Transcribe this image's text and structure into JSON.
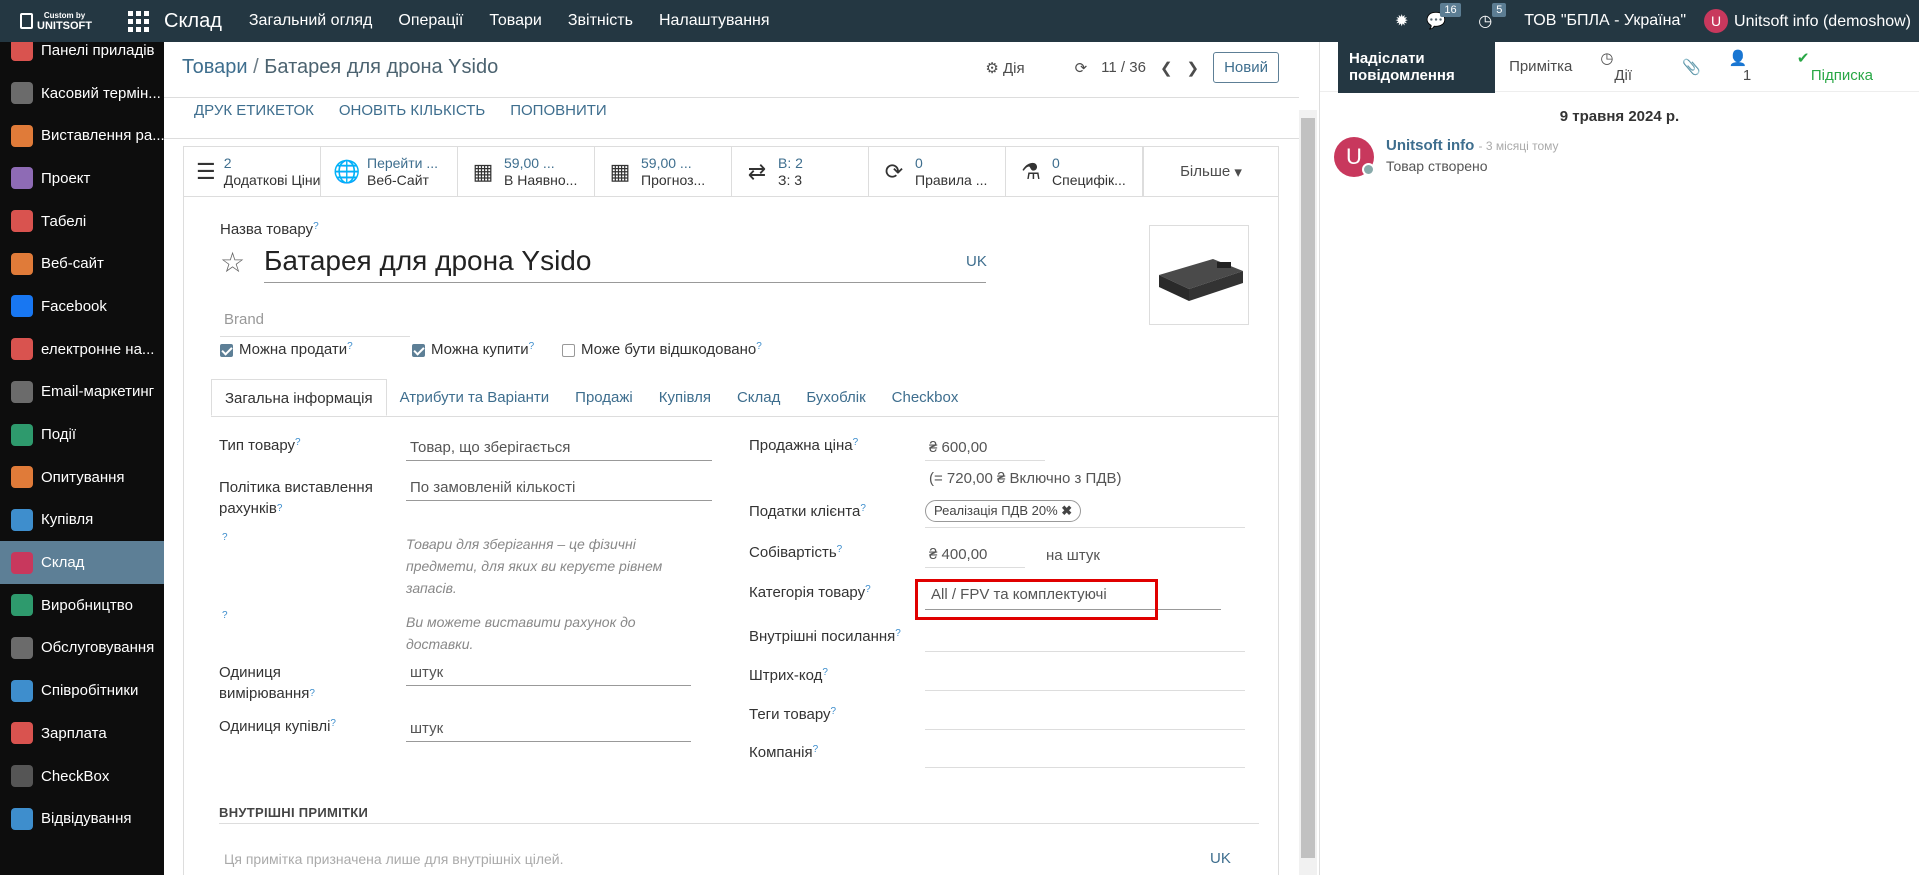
{
  "topbar": {
    "logo_top": "Custom by",
    "logo_bottom": "UNITSOFT",
    "app_name": "Склад",
    "menu": [
      "Загальний огляд",
      "Операції",
      "Товари",
      "Звітність",
      "Налаштування"
    ],
    "messages_count": "16",
    "activities_count": "5",
    "company": "ТОВ \"БПЛА - Україна\"",
    "user_initial": "U",
    "user": "Unitsoft info (demoshow)"
  },
  "sidebar": {
    "items": [
      {
        "label": "Панелі приладів",
        "color": "#d9534f"
      },
      {
        "label": "Касовий термін...",
        "color": "#6b6b6b"
      },
      {
        "label": "Виставлення ра...",
        "color": "#e07b39"
      },
      {
        "label": "Проект",
        "color": "#8e6bb5"
      },
      {
        "label": "Табелі",
        "color": "#d9534f"
      },
      {
        "label": "Веб-сайт",
        "color": "#e07b39"
      },
      {
        "label": "Facebook",
        "color": "#1877f2"
      },
      {
        "label": "електронне на...",
        "color": "#d9534f"
      },
      {
        "label": "Email-маркетинг",
        "color": "#6b6b6b"
      },
      {
        "label": "Події",
        "color": "#2e9a6d"
      },
      {
        "label": "Опитування",
        "color": "#e07b39"
      },
      {
        "label": "Купівля",
        "color": "#3e8ecd"
      },
      {
        "label": "Склад",
        "color": "#c8385d",
        "active": true
      },
      {
        "label": "Виробництво",
        "color": "#2e9a6d"
      },
      {
        "label": "Обслуговування",
        "color": "#6b6b6b"
      },
      {
        "label": "Співробітники",
        "color": "#3e8ecd"
      },
      {
        "label": "Зарплата",
        "color": "#d9534f"
      },
      {
        "label": "CheckBox",
        "color": "#555555"
      },
      {
        "label": "Відвідування",
        "color": "#3e8ecd"
      }
    ]
  },
  "header": {
    "crumb_parent": "Товари",
    "crumb_sep": "/",
    "crumb_current": "Батарея для дрона Ysido",
    "action_label": "Дія",
    "pager": "11 / 36",
    "new_button": "Новий"
  },
  "actions": [
    "ДРУК ЕТИКЕТОК",
    "ОНОВІТЬ КІЛЬКІСТЬ",
    "ПОПОВНИТИ"
  ],
  "smart_buttons": [
    {
      "icon": "list-icon",
      "num": "2",
      "text": "Додаткові Ціни"
    },
    {
      "icon": "globe-icon",
      "num": "Перейти ...",
      "text": "Веб-Сайт"
    },
    {
      "icon": "cubes-icon",
      "num": "59,00 ...",
      "text": "В Наявно..."
    },
    {
      "icon": "cubes-forecast-icon",
      "num": "59,00 ...",
      "text": "Прогноз..."
    },
    {
      "icon": "exchange-icon",
      "num": "В:  2",
      "text": "З:  3"
    },
    {
      "icon": "refresh-icon",
      "num": "0",
      "text": "Правила ..."
    },
    {
      "icon": "flask-icon",
      "num": "0",
      "text": "Специфік..."
    }
  ],
  "more_label": "Більше",
  "product": {
    "name_label": "Назва товару",
    "name": "Батарея для дрона Ysido",
    "lang": "UK",
    "brand_placeholder": "Brand",
    "can_sell": "Можна продати",
    "can_buy": "Можна купити",
    "can_reimburse": "Може бути відшкодовано"
  },
  "tabs": [
    "Загальна інформація",
    "Атрибути та Варіанти",
    "Продажі",
    "Купівля",
    "Склад",
    "Бухоблік",
    "Checkbox"
  ],
  "left_fields": {
    "type_label": "Тип товару",
    "type_value": "Товар, що зберігається",
    "policy_label": "Політика виставлення рахунків",
    "policy_value": "По замовленій кількості",
    "help1": "Товари для зберігання – це фізичні предмети, для яких ви керуєте рівнем запасів.",
    "help2": "Ви можете виставити рахунок до доставки.",
    "uom_label": "Одиниця вимірювання",
    "uom_value": "штук",
    "po_uom_label": "Одиниця купівлі",
    "po_uom_value": "штук"
  },
  "right_fields": {
    "price_label": "Продажна ціна",
    "price_value": "₴ 600,00",
    "price_incl": "(= 720,00 ₴ Включно з ПДВ)",
    "taxes_label": "Податки клієнта",
    "tax_tag": "Реалізація ПДВ 20%",
    "cost_label": "Собівартість",
    "cost_value": "₴ 400,00",
    "cost_unit": "на штук",
    "categ_label": "Категорія товару",
    "categ_value": "All / FPV та комплектуючі",
    "ref_label": "Внутрішні посилання",
    "barcode_label": "Штрих-код",
    "tags_label": "Теги товару",
    "company_label": "Компанія"
  },
  "notes": {
    "title": "ВНУТРІШНІ ПРИМІТКИ",
    "placeholder": "Ця примітка призначена лише для внутрішніх цілей.",
    "lang": "UK"
  },
  "chatter": {
    "send": "Надіслати повідомлення",
    "note": "Примітка",
    "activities": "Дії",
    "followers": "1",
    "follow": "Підписка",
    "date": "9 травня 2024 р.",
    "author": "Unitsoft info",
    "time": "- 3 місяці тому",
    "body": "Товар створено"
  }
}
